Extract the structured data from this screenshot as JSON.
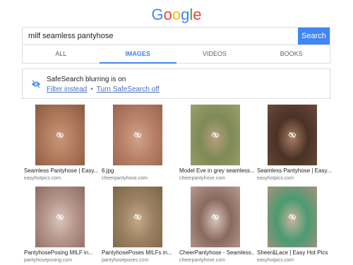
{
  "logo": [
    "G",
    "o",
    "o",
    "g",
    "l",
    "e"
  ],
  "logo_colors": [
    "#4285f4",
    "#ea4335",
    "#fbbc05",
    "#4285f4",
    "#34a853",
    "#ea4335"
  ],
  "search": {
    "value": "milf seamless pantyhose",
    "button_label": "Search"
  },
  "tabs": [
    {
      "label": "ALL",
      "active": false
    },
    {
      "label": "IMAGES",
      "active": true
    },
    {
      "label": "VIDEOS",
      "active": false
    },
    {
      "label": "BOOKS",
      "active": false
    }
  ],
  "safesearch": {
    "title": "SafeSearch blurring is on",
    "link1": "Filter instead",
    "separator": "•",
    "link2": "Turn SafeSearch off"
  },
  "results": [
    {
      "title": "Seamless Pantyhose | Easy...",
      "source": "easyhotpics.com",
      "colors": [
        "#b07a5c",
        "#8a5a44",
        "#c9967a"
      ]
    },
    {
      "title": "6.jpg",
      "source": "cheerpantyhose.com",
      "colors": [
        "#b98168",
        "#9a6450",
        "#d0a48c"
      ]
    },
    {
      "title": "Model Eve in grey seamless...",
      "source": "cheerpantyhose.com",
      "colors": [
        "#7e8a57",
        "#9aa06c",
        "#b6a07c"
      ]
    },
    {
      "title": "Seamless Pantyhose | Easy...",
      "source": "easyhotpics.com",
      "colors": [
        "#4a3226",
        "#6a4a38",
        "#a87c62"
      ]
    },
    {
      "title": "PantyhosePosing MILF in...",
      "source": "pantyhoseposing.com",
      "colors": [
        "#b6958a",
        "#8c6c62",
        "#d8c4bc"
      ]
    },
    {
      "title": "PantyhosePoses MILFs in...",
      "source": "pantyhoseposes.com",
      "colors": [
        "#9c8262",
        "#7a6448",
        "#c4aa88"
      ]
    },
    {
      "title": "CheerPantyhose - Seamless...",
      "source": "cheerpantyhose.com",
      "colors": [
        "#8a6a5e",
        "#b89a90",
        "#d6c4bc"
      ]
    },
    {
      "title": "Sheer&Lace | Easy Hot Pics",
      "source": "easyhotpics.com",
      "colors": [
        "#4a9a72",
        "#a8927a",
        "#c8b49a"
      ]
    }
  ]
}
